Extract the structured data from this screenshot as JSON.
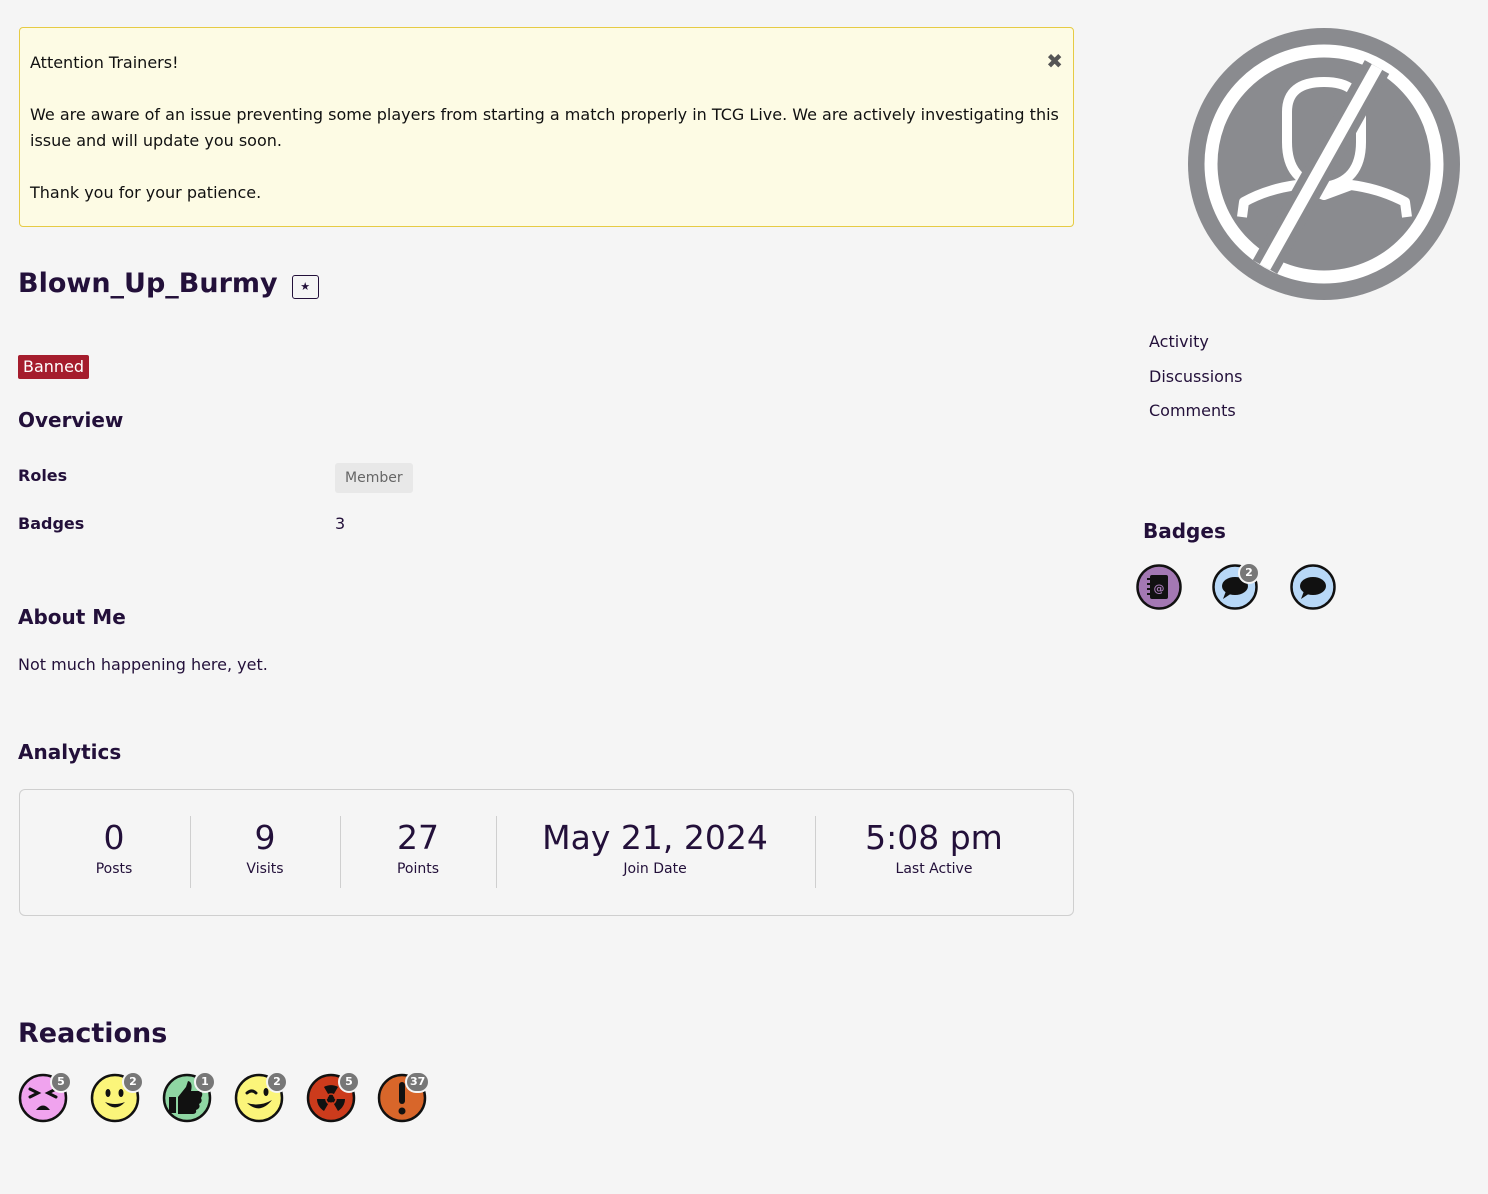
{
  "notice": {
    "line1": "Attention Trainers!",
    "line2": "We are aware of an issue preventing some players from starting a match properly in TCG Live. We are actively investigating this issue and will update you soon.",
    "line3": "Thank you for your patience.",
    "close_glyph": "✖"
  },
  "profile": {
    "username": "Blown_Up_Burmy",
    "star_glyph": "★",
    "status_badge": "Banned"
  },
  "overview": {
    "title": "Overview",
    "roles_label": "Roles",
    "roles_value": "Member",
    "badges_label": "Badges",
    "badges_value": "3"
  },
  "about": {
    "title": "About Me",
    "text": "Not much happening here, yet."
  },
  "analytics": {
    "title": "Analytics",
    "stats": [
      {
        "value": "0",
        "label": "Posts"
      },
      {
        "value": "9",
        "label": "Visits"
      },
      {
        "value": "27",
        "label": "Points"
      },
      {
        "value": "May 21, 2024",
        "label": "Join Date"
      },
      {
        "value": "5:08 pm",
        "label": "Last Active"
      }
    ]
  },
  "reactions": {
    "title": "Reactions",
    "items": [
      {
        "icon": "angry-face-icon",
        "count": "5",
        "color": "#f0a3ee"
      },
      {
        "icon": "smile-face-icon",
        "count": "2",
        "color": "#fbf57a"
      },
      {
        "icon": "thumbs-up-icon",
        "count": "1",
        "color": "#8fd6a3"
      },
      {
        "icon": "wink-face-icon",
        "count": "2",
        "color": "#fbf57a"
      },
      {
        "icon": "radioactive-icon",
        "count": "5",
        "color": "#cc3b1c"
      },
      {
        "icon": "exclamation-icon",
        "count": "37",
        "color": "#d8662a"
      }
    ]
  },
  "sidebar": {
    "links": [
      "Activity",
      "Discussions",
      "Comments"
    ],
    "badges_title": "Badges",
    "badges": [
      {
        "icon": "address-book-icon",
        "count": null,
        "color": "#a378b3"
      },
      {
        "icon": "speech-bubble-icon",
        "count": "2",
        "color": "#b8d8f7"
      },
      {
        "icon": "speech-bubble-icon",
        "count": null,
        "color": "#b8d8f7"
      }
    ]
  },
  "colors": {
    "accent": "#23103a",
    "banned": "#a51d2d",
    "notice_bg": "#fdfbe4",
    "notice_border": "#e6cb44"
  }
}
